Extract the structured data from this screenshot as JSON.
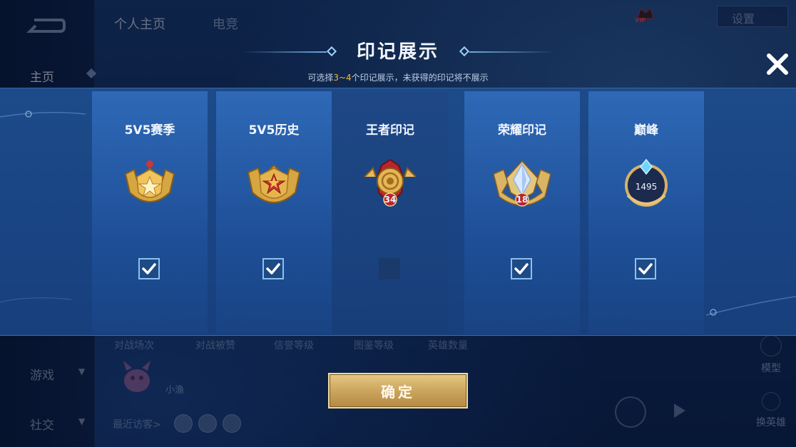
{
  "background": {
    "nav": {
      "home": "主页",
      "games": "游戏",
      "social": "社交"
    },
    "tabs": {
      "profile": "个人主页",
      "esports": "电竞"
    },
    "settings_label": "设置",
    "vip_label": "VIP",
    "stats": [
      "对战场次",
      "对战被赞",
      "信誉等级",
      "图鉴等级",
      "英雄数量"
    ],
    "player_name": "小渔",
    "visitors_label": "最近访客>",
    "model_label": "模型",
    "swap_hero_label": "换英雄"
  },
  "modal": {
    "title": "印记展示",
    "subtitle_prefix": "可选择",
    "subtitle_highlight": "3~4",
    "subtitle_suffix": "个印记展示，未获得的印记将不展示",
    "confirm_label": "确定",
    "cards": [
      {
        "label": "5V5赛季",
        "badge": "gold-star-badge-icon",
        "checked": true
      },
      {
        "label": "5V5历史",
        "badge": "gold-star-badge-icon",
        "checked": true
      },
      {
        "label": "王者印记",
        "badge": "king-emblem-icon",
        "number": "34",
        "checked": false
      },
      {
        "label": "荣耀印记",
        "badge": "glory-crystal-badge-icon",
        "number": "18",
        "checked": true
      },
      {
        "label": "巅峰",
        "badge": "peak-diamond-icon",
        "number": "1495",
        "checked": true
      }
    ]
  },
  "colors": {
    "accent_gold": "#f2b93c",
    "checkbox_border": "#8cc0f0",
    "band_blue": "#1d4a88"
  }
}
